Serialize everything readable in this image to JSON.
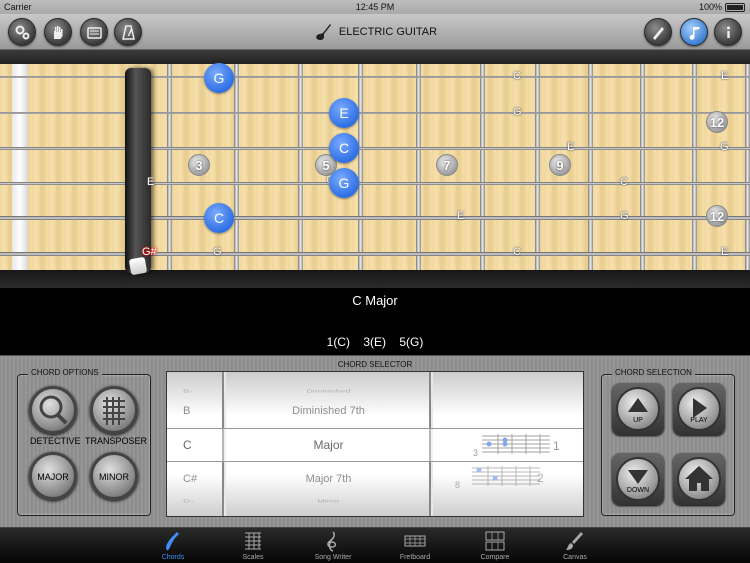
{
  "status": {
    "carrier": "Carrier",
    "time": "12:45 PM",
    "battery": "100%"
  },
  "header": {
    "title": "ELECTRIC GUITAR"
  },
  "fretboard": {
    "note_bubbles": [
      "G",
      "E",
      "C",
      "G",
      "C"
    ],
    "fret_markers": [
      "3",
      "5",
      "7",
      "9",
      "12",
      "12"
    ],
    "note_labels": [
      "C",
      "E",
      "G",
      "E",
      "G",
      "E",
      "C",
      "E",
      "G",
      "G",
      "C",
      "E",
      "G",
      "G",
      "G",
      "C",
      "E",
      "G#"
    ]
  },
  "chord": {
    "name": "C Major",
    "tones": [
      "1(C)",
      "3(E)",
      "5(G)"
    ]
  },
  "chord_options": {
    "title": "CHORD OPTIONS",
    "detective": "DETECTIVE",
    "transposer": "TRANSPOSER",
    "major": "MAJOR",
    "minor": "MINOR"
  },
  "chord_selector": {
    "title": "CHORD SELECTOR",
    "notes": [
      "B♭",
      "B",
      "C",
      "C#",
      "D♭"
    ],
    "types": [
      "Diminished",
      "Diminished 7th",
      "Major",
      "Major 7th",
      "Minor"
    ],
    "positions": [
      "1",
      "2"
    ],
    "fret_nums": [
      "3",
      "8"
    ]
  },
  "chord_selection": {
    "title": "CHORD SELECTION",
    "up": "UP",
    "play": "PLAY",
    "down": "DOWN"
  },
  "tabs": [
    {
      "label": "Chords",
      "active": true
    },
    {
      "label": "Scales"
    },
    {
      "label": "Song Writer"
    },
    {
      "label": "Fretboard"
    },
    {
      "label": "Compare"
    },
    {
      "label": "Canvas"
    }
  ],
  "colors": {
    "accent": "#3d8ff7",
    "note_bubble": "#2e6fe4"
  }
}
